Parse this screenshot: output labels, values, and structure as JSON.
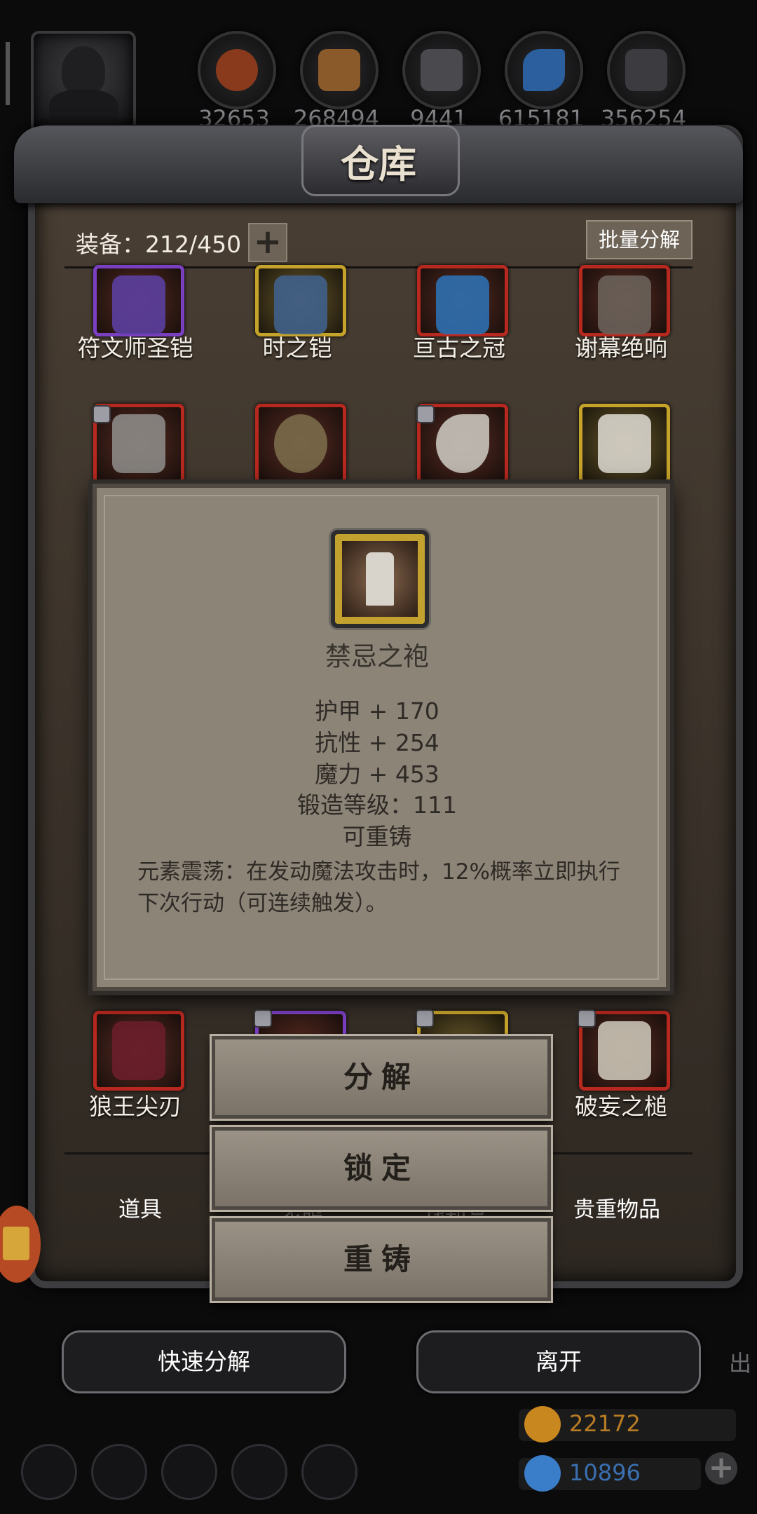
{
  "resources": {
    "counts": [
      "32653",
      "268494",
      "9441",
      "615181",
      "356254"
    ],
    "icons": [
      "meat-icon",
      "wood-icon",
      "iron-icon",
      "crystal-icon",
      "stone-icon"
    ]
  },
  "warehouse": {
    "title": "仓库",
    "equip_count": "装备：212/450",
    "plus": "+",
    "batch_decompose": "批量分解"
  },
  "items": {
    "row1": [
      "符文师圣铠",
      "时之铠",
      "亘古之冠",
      "谢幕绝响"
    ],
    "row3": [
      "狼王尖刃",
      "",
      "",
      "破妄之槌"
    ]
  },
  "detail": {
    "name": "禁忌之袍",
    "stats": [
      "护甲 + 170",
      "抗性 + 254",
      "魔力 + 453",
      "锻造等级：111",
      "可重铸"
    ],
    "description": "元素震荡：在发动魔法攻击时，12%概率立即执行下次行动（可连续触发）。"
  },
  "actions": {
    "decompose": "分解",
    "lock": "锁定",
    "recast": "重铸"
  },
  "tabs": {
    "props": "道具",
    "outfit": "衣服",
    "spoils": "战利品",
    "valuables": "贵重物品"
  },
  "bottom": {
    "quick_decompose": "快速分解",
    "leave": "离开",
    "side_text": "出"
  },
  "currency": {
    "gold": "22172",
    "gems": "10896",
    "gold_color": "#c9871f",
    "gem_color": "#3a7ec9"
  },
  "colors": {
    "red_rarity": "#b7281f",
    "gold_rarity": "#c5a22a",
    "parchment": "#8d8478"
  }
}
